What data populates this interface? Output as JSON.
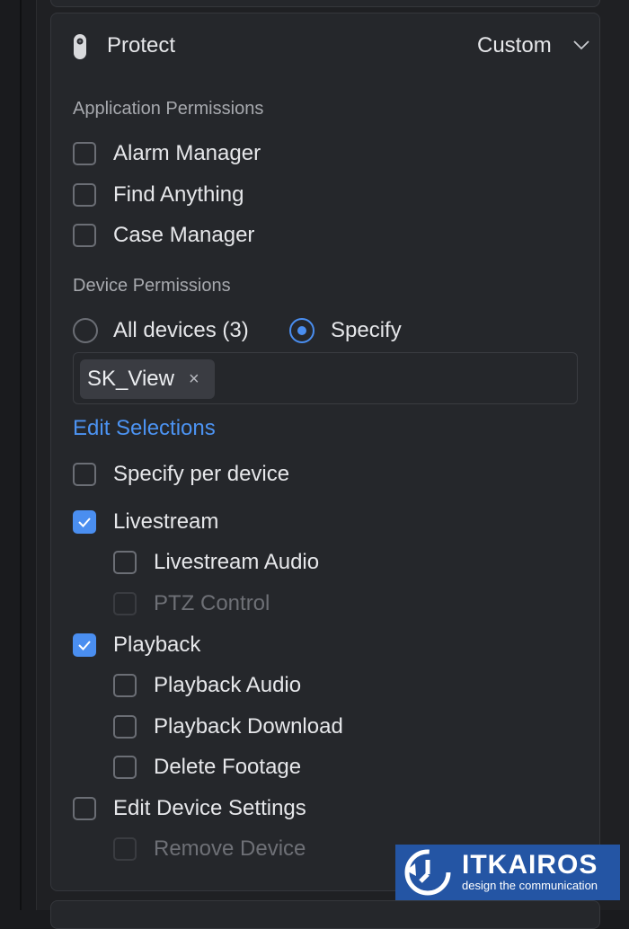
{
  "product": {
    "name": "Protect",
    "mode": "Custom"
  },
  "application_permissions": {
    "heading": "Application Permissions",
    "items": [
      {
        "label": "Alarm Manager",
        "checked": false
      },
      {
        "label": "Find Anything",
        "checked": false
      },
      {
        "label": "Case Manager",
        "checked": false
      }
    ]
  },
  "device_permissions": {
    "heading": "Device Permissions",
    "all_devices_label": "All devices (3)",
    "specify_label": "Specify",
    "selected_option": "Specify",
    "selected_devices": [
      {
        "name": "SK_View",
        "remove_symbol": "×"
      }
    ],
    "edit_selections_label": "Edit Selections",
    "specify_per_device_label": "Specify per device",
    "livestream": {
      "label": "Livestream",
      "checked": true
    },
    "livestream_audio": {
      "label": "Livestream Audio",
      "checked": false
    },
    "ptz_control": {
      "label": "PTZ Control",
      "checked": false,
      "disabled": true
    },
    "playback": {
      "label": "Playback",
      "checked": true
    },
    "playback_audio": {
      "label": "Playback Audio",
      "checked": false
    },
    "playback_download": {
      "label": "Playback Download",
      "checked": false
    },
    "delete_footage": {
      "label": "Delete Footage",
      "checked": false
    },
    "edit_device_settings": {
      "label": "Edit Device Settings",
      "checked": false
    },
    "remove_device": {
      "label": "Remove Device",
      "checked": false,
      "disabled": true
    }
  },
  "watermark": {
    "title": "ITKAIROS",
    "subtitle": "design the communication"
  },
  "colors": {
    "accent": "#4a8ef0",
    "link": "#4c93f2",
    "background": "#1a1b1e",
    "card": "#25272b"
  },
  "icons": {
    "product": "camera-device-icon",
    "expand": "chevron-down-icon",
    "check": "check-icon"
  }
}
